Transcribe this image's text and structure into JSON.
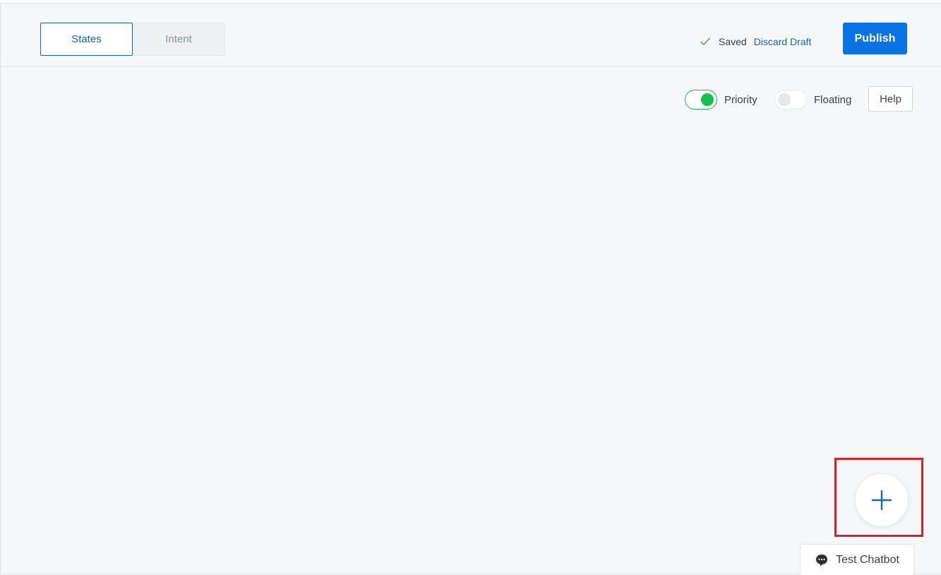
{
  "header": {
    "tabs": [
      {
        "label": "States",
        "active": true
      },
      {
        "label": "Intent",
        "active": false
      }
    ],
    "status": {
      "icon": "check-icon",
      "saved_text": "Saved",
      "discard_label": "Discard Draft"
    },
    "publish_label": "Publish"
  },
  "toolbar": {
    "priority": {
      "label": "Priority",
      "enabled": true
    },
    "floating": {
      "label": "Floating",
      "enabled": false
    },
    "help_label": "Help"
  },
  "canvas": {
    "add_button_icon": "plus-icon",
    "test_chatbot_label": "Test Chatbot",
    "test_chatbot_icon": "chat-bubble-icon"
  },
  "colors": {
    "accent": "#0a73e3",
    "link": "#1565c0",
    "toggle_on": "#13c24c",
    "highlight": "#d7202a",
    "background": "#f6f7f9"
  }
}
